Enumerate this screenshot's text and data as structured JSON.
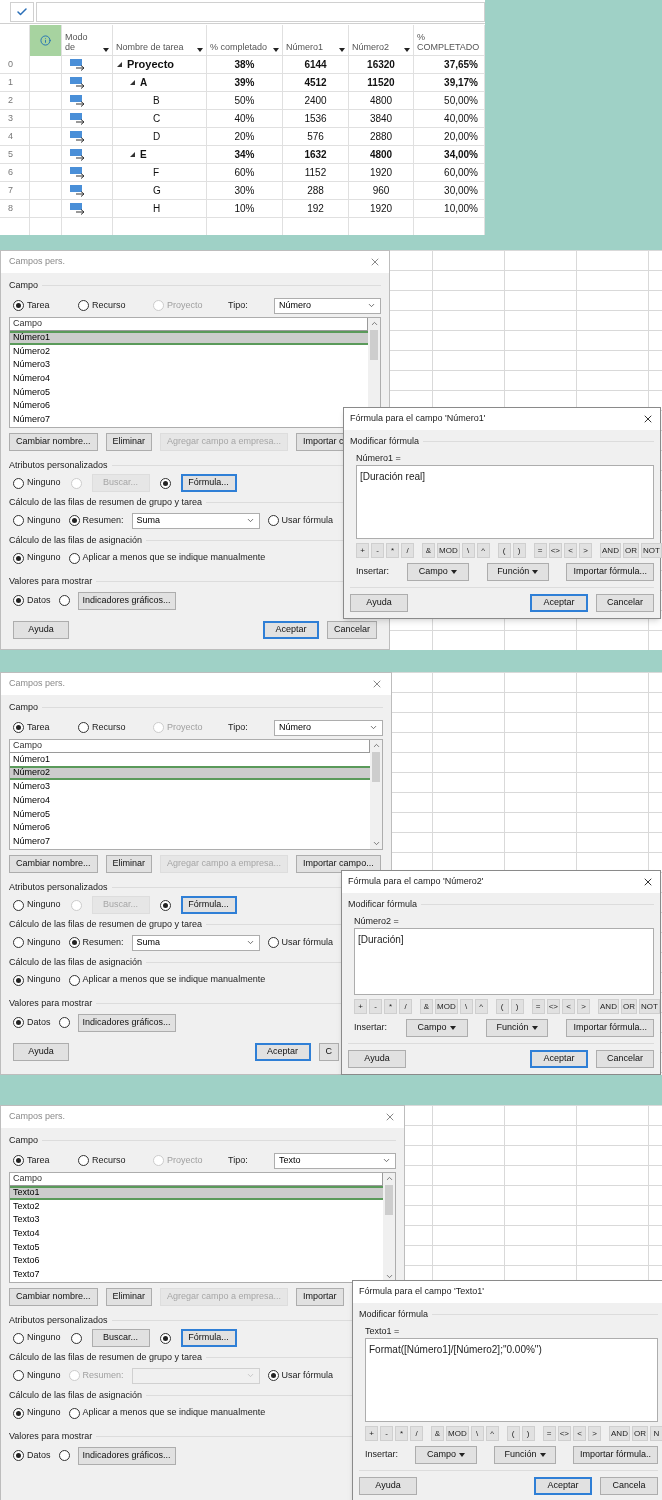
{
  "task_table": {
    "columns": [
      "Modo de",
      "Nombre de tarea",
      "% completado",
      "Número1",
      "Número2",
      "% COMPLETADO"
    ],
    "rows": [
      {
        "id": "0",
        "name": "Proyecto",
        "pct": "38%",
        "num1": "6144",
        "num2": "16320",
        "pct_text": "37,65%",
        "expanded": true,
        "children": [
          {
            "id": "1",
            "name": "A",
            "pct": "39%",
            "num1": "4512",
            "num2": "11520",
            "pct_text": "39,17%",
            "expanded": true,
            "children": [
              {
                "id": "2",
                "name": "B",
                "pct": "50%",
                "num1": "2400",
                "num2": "4800",
                "pct_text": "50,00%"
              },
              {
                "id": "3",
                "name": "C",
                "pct": "40%",
                "num1": "1536",
                "num2": "3840",
                "pct_text": "40,00%"
              },
              {
                "id": "4",
                "name": "D",
                "pct": "20%",
                "num1": "576",
                "num2": "2880",
                "pct_text": "20,00%"
              }
            ]
          },
          {
            "id": "5",
            "name": "E",
            "pct": "34%",
            "num1": "1632",
            "num2": "4800",
            "pct_text": "34,00%",
            "expanded": true,
            "children": [
              {
                "id": "6",
                "name": "F",
                "pct": "60%",
                "num1": "1152",
                "num2": "1920",
                "pct_text": "60,00%"
              },
              {
                "id": "7",
                "name": "G",
                "pct": "30%",
                "num1": "288",
                "num2": "960",
                "pct_text": "30,00%"
              },
              {
                "id": "8",
                "name": "H",
                "pct": "10%",
                "num1": "192",
                "num2": "1920",
                "pct_text": "10,00%"
              }
            ]
          }
        ]
      }
    ]
  },
  "panels": [
    {
      "dialog": {
        "title": "Campos pers.",
        "field_section": "Campo",
        "entity": [
          {
            "label": "Tarea",
            "selected": true,
            "disabled": false
          },
          {
            "label": "Recurso",
            "selected": false,
            "disabled": false
          },
          {
            "label": "Proyecto",
            "selected": false,
            "disabled": true
          }
        ],
        "type_label": "Tipo:",
        "type_value": "Número",
        "list_header": "Campo",
        "fields": [
          {
            "label": "Número1",
            "selected": true
          },
          {
            "label": "Número2",
            "selected": false
          },
          {
            "label": "Número3",
            "selected": false
          },
          {
            "label": "Número4",
            "selected": false
          },
          {
            "label": "Número5",
            "selected": false
          },
          {
            "label": "Número6",
            "selected": false
          },
          {
            "label": "Número7",
            "selected": false
          }
        ],
        "buttons": [
          {
            "label": "Cambiar nombre...",
            "disabled": false
          },
          {
            "label": "Eliminar",
            "disabled": false
          },
          {
            "label": "Agregar campo a empresa...",
            "disabled": true
          },
          {
            "label": "Importar c",
            "disabled": false
          }
        ],
        "attributes": {
          "label": "Atributos personalizados",
          "none": {
            "label": "Ninguno",
            "selected": false
          },
          "lookup": {
            "selected": false,
            "disabled": true,
            "button": "Buscar..."
          },
          "formula": {
            "selected": true,
            "button": "Fórmula..."
          }
        },
        "summary": {
          "label": "Cálculo de las filas de resumen de grupo y tarea",
          "none": {
            "label": "Ninguno",
            "selected": false
          },
          "rollup": {
            "label": "Resumen:",
            "selected": true,
            "disabled": false,
            "value": "Suma"
          },
          "use_formula": {
            "label": "Usar fórmula",
            "selected": false
          }
        },
        "assignment": {
          "label": "Cálculo de las filas de asignación",
          "options": [
            {
              "label": "Ninguno",
              "selected": true
            },
            {
              "label": "Aplicar a menos que se indique manualmente",
              "selected": false
            }
          ]
        },
        "display": {
          "label": "Valores para mostrar",
          "data": {
            "label": "Datos",
            "selected": true
          },
          "indicators": {
            "selected": false,
            "button": "Indicadores gráficos..."
          }
        },
        "footer": [
          {
            "label": "Ayuda",
            "default": false
          },
          {
            "label": "Aceptar",
            "default": true
          },
          {
            "label": "Cancelar",
            "default": false
          }
        ]
      },
      "formula": {
        "title": "Fórmula para el campo 'Número1'",
        "close": true,
        "section": "Modificar fórmula",
        "field_label": "Número1 =",
        "expression": "[Duración real]",
        "operators": [
          [
            "+",
            "-",
            "*",
            "/"
          ],
          [
            "&",
            "MOD",
            "\\",
            "^"
          ],
          [
            "(",
            ")"
          ],
          [
            "=",
            "<>",
            "<",
            ">"
          ],
          [
            "AND",
            "OR",
            "NOT"
          ]
        ],
        "insert_label": "Insertar:",
        "insert_buttons": [
          {
            "label": "Campo",
            "menu": true
          },
          {
            "label": "Función",
            "menu": true
          },
          {
            "label": "Importar fórmula...",
            "menu": false
          }
        ],
        "footer": [
          {
            "label": "Ayuda",
            "default": false
          },
          {
            "label": "Aceptar",
            "default": true
          },
          {
            "label": "Cancelar",
            "default": false
          }
        ]
      }
    },
    {
      "dialog": {
        "title": "Campos pers.",
        "field_section": "Campo",
        "entity": [
          {
            "label": "Tarea",
            "selected": true,
            "disabled": false
          },
          {
            "label": "Recurso",
            "selected": false,
            "disabled": false
          },
          {
            "label": "Proyecto",
            "selected": false,
            "disabled": true
          }
        ],
        "type_label": "Tipo:",
        "type_value": "Número",
        "list_header": "Campo",
        "fields": [
          {
            "label": "Número1",
            "selected": false
          },
          {
            "label": "Número2",
            "selected": true
          },
          {
            "label": "Número3",
            "selected": false
          },
          {
            "label": "Número4",
            "selected": false
          },
          {
            "label": "Número5",
            "selected": false
          },
          {
            "label": "Número6",
            "selected": false
          },
          {
            "label": "Número7",
            "selected": false
          }
        ],
        "buttons": [
          {
            "label": "Cambiar nombre...",
            "disabled": false
          },
          {
            "label": "Eliminar",
            "disabled": false
          },
          {
            "label": "Agregar campo a empresa...",
            "disabled": true
          },
          {
            "label": "Importar campo...",
            "disabled": false
          }
        ],
        "attributes": {
          "label": "Atributos personalizados",
          "none": {
            "label": "Ninguno",
            "selected": false
          },
          "lookup": {
            "selected": false,
            "disabled": true,
            "button": "Buscar..."
          },
          "formula": {
            "selected": true,
            "button": "Fórmula..."
          }
        },
        "summary": {
          "label": "Cálculo de las filas de resumen de grupo y tarea",
          "none": {
            "label": "Ninguno",
            "selected": false
          },
          "rollup": {
            "label": "Resumen:",
            "selected": true,
            "disabled": false,
            "value": "Suma"
          },
          "use_formula": {
            "label": "Usar fórmula",
            "selected": false
          }
        },
        "assignment": {
          "label": "Cálculo de las filas de asignación",
          "options": [
            {
              "label": "Ninguno",
              "selected": true
            },
            {
              "label": "Aplicar a menos que se indique manualmente",
              "selected": false
            }
          ]
        },
        "display": {
          "label": "Valores para mostrar",
          "data": {
            "label": "Datos",
            "selected": true
          },
          "indicators": {
            "selected": false,
            "button": "Indicadores gráficos..."
          }
        },
        "footer": [
          {
            "label": "Ayuda",
            "default": false
          },
          {
            "label": "Aceptar",
            "default": true
          },
          {
            "label": "C",
            "default": false
          }
        ]
      },
      "formula": {
        "title": "Fórmula para el campo 'Número2'",
        "close": true,
        "section": "Modificar fórmula",
        "field_label": "Número2 =",
        "expression": "[Duración]",
        "operators": [
          [
            "+",
            "-",
            "*",
            "/"
          ],
          [
            "&",
            "MOD",
            "\\",
            "^"
          ],
          [
            "(",
            ")"
          ],
          [
            "=",
            "<>",
            "<",
            ">"
          ],
          [
            "AND",
            "OR",
            "NOT"
          ]
        ],
        "insert_label": "Insertar:",
        "insert_buttons": [
          {
            "label": "Campo",
            "menu": true
          },
          {
            "label": "Función",
            "menu": true
          },
          {
            "label": "Importar fórmula...",
            "menu": false
          }
        ],
        "footer": [
          {
            "label": "Ayuda",
            "default": false
          },
          {
            "label": "Aceptar",
            "default": true
          },
          {
            "label": "Cancelar",
            "default": false
          }
        ]
      }
    },
    {
      "dialog": {
        "title": "Campos pers.",
        "field_section": "Campo",
        "entity": [
          {
            "label": "Tarea",
            "selected": true,
            "disabled": false
          },
          {
            "label": "Recurso",
            "selected": false,
            "disabled": false
          },
          {
            "label": "Proyecto",
            "selected": false,
            "disabled": true
          }
        ],
        "type_label": "Tipo:",
        "type_value": "Texto",
        "list_header": "Campo",
        "fields": [
          {
            "label": "Texto1",
            "selected": true
          },
          {
            "label": "Texto2",
            "selected": false
          },
          {
            "label": "Texto3",
            "selected": false
          },
          {
            "label": "Texto4",
            "selected": false
          },
          {
            "label": "Texto5",
            "selected": false
          },
          {
            "label": "Texto6",
            "selected": false
          },
          {
            "label": "Texto7",
            "selected": false
          }
        ],
        "buttons": [
          {
            "label": "Cambiar nombre...",
            "disabled": false
          },
          {
            "label": "Eliminar",
            "disabled": false
          },
          {
            "label": "Agregar campo a empresa...",
            "disabled": true
          },
          {
            "label": "Importar",
            "disabled": false
          }
        ],
        "attributes": {
          "label": "Atributos personalizados",
          "none": {
            "label": "Ninguno",
            "selected": false
          },
          "lookup": {
            "selected": false,
            "disabled": false,
            "button": "Buscar..."
          },
          "formula": {
            "selected": true,
            "button": "Fórmula..."
          }
        },
        "summary": {
          "label": "Cálculo de las filas de resumen de grupo y tarea",
          "none": {
            "label": "Ninguno",
            "selected": false
          },
          "rollup": {
            "label": "Resumen:",
            "selected": false,
            "disabled": true
          },
          "use_formula": {
            "label": "Usar fórmula",
            "selected": true
          }
        },
        "assignment": {
          "label": "Cálculo de las filas de asignación",
          "options": [
            {
              "label": "Ninguno",
              "selected": true
            },
            {
              "label": "Aplicar a menos que se indique manualmente",
              "selected": false
            }
          ]
        },
        "display": {
          "label": "Valores para mostrar",
          "data": {
            "label": "Datos",
            "selected": true
          },
          "indicators": {
            "selected": false,
            "button": "Indicadores gráficos..."
          }
        }
      },
      "formula": {
        "title": "Fórmula para el campo 'Texto1'",
        "close": false,
        "section": "Modificar fórmula",
        "field_label": "Texto1 =",
        "expression": "Format([Número1]/[Número2];\"0.00%\")",
        "operators": [
          [
            "+",
            "-",
            "*",
            "/"
          ],
          [
            "&",
            "MOD",
            "\\",
            "^"
          ],
          [
            "(",
            ")"
          ],
          [
            "=",
            "<>",
            "<",
            ">"
          ],
          [
            "AND",
            "OR",
            "N"
          ]
        ],
        "insert_label": "Insertar:",
        "insert_buttons": [
          {
            "label": "Campo",
            "menu": true
          },
          {
            "label": "Función",
            "menu": true
          },
          {
            "label": "Importar fórmula..",
            "menu": false
          }
        ],
        "footer": [
          {
            "label": "Ayuda",
            "default": false
          },
          {
            "label": "Aceptar",
            "default": true
          },
          {
            "label": "Cancela",
            "default": false
          }
        ]
      }
    }
  ]
}
